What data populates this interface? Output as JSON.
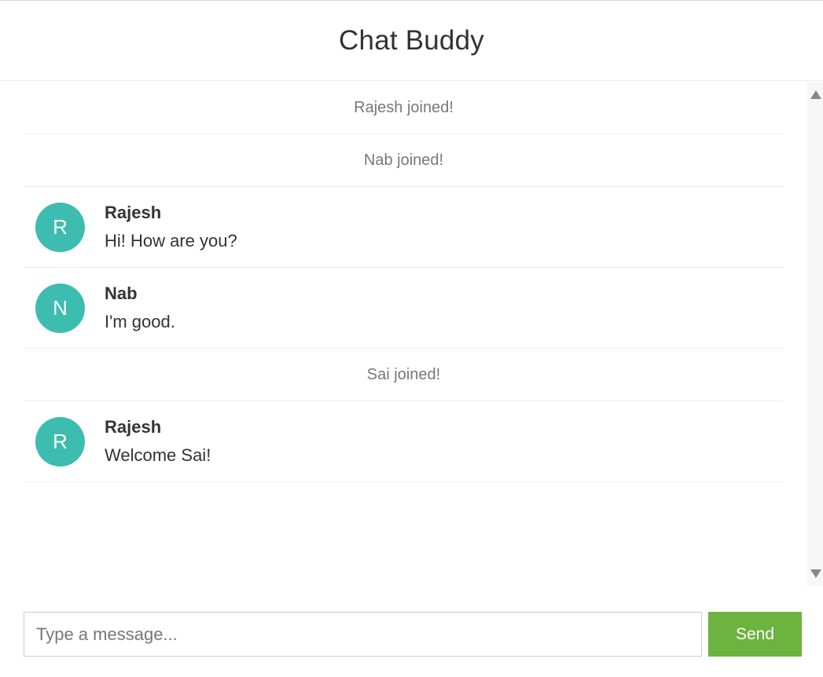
{
  "app": {
    "title": "Chat Buddy"
  },
  "messages": [
    {
      "type": "event",
      "text": "Rajesh joined!"
    },
    {
      "type": "event",
      "text": "Nab joined!"
    },
    {
      "type": "chat",
      "initial": "R",
      "author": "Rajesh",
      "text": "Hi! How are you?"
    },
    {
      "type": "chat",
      "initial": "N",
      "author": "Nab",
      "text": "I'm good."
    },
    {
      "type": "event",
      "text": "Sai joined!"
    },
    {
      "type": "chat",
      "initial": "R",
      "author": "Rajesh",
      "text": "Welcome Sai!"
    }
  ],
  "composer": {
    "placeholder": "Type a message...",
    "value": "",
    "send_label": "Send"
  },
  "colors": {
    "avatar": "#3dbcb0",
    "send_button": "#6db33f"
  },
  "icons": {
    "scroll_up": "triangle-up-icon",
    "scroll_down": "triangle-down-icon"
  }
}
